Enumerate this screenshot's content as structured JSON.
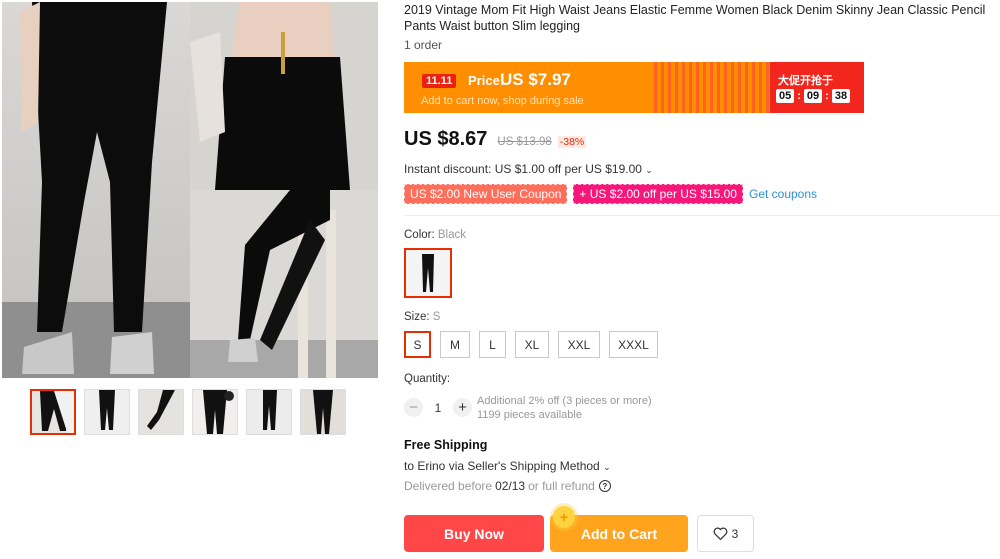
{
  "product": {
    "title": "2019 Vintage Mom Fit High Waist Jeans Elastic Femme Women Black Denim Skinny Jean Classic Pencil Pants Waist button Slim legging",
    "orders": "1 order"
  },
  "promo": {
    "tag": "11.11",
    "price_label": "Price:",
    "price": "US $7.97",
    "subtitle": "Add to cart now, shop during sale",
    "sale_text": "大促开抢于",
    "countdown": [
      "05",
      "09",
      "38"
    ],
    "colors": {
      "bar": "#ff8f00",
      "countdown_bg": "#f2261d"
    }
  },
  "pricing": {
    "current": "US $8.67",
    "original": "US $13.98",
    "discount": "-38%",
    "instant_discount": "Instant discount: US $1.00 off per US $19.00",
    "coupons": [
      "US $2.00 New User Coupon",
      "+ US $2.00 off per US $15.00"
    ],
    "get_coupons": "Get coupons"
  },
  "color": {
    "label": "Color:",
    "value": "Black",
    "swatch_icon": "black-pants-swatch"
  },
  "size": {
    "label": "Size:",
    "value": "S",
    "options": [
      "S",
      "M",
      "L",
      "XL",
      "XXL",
      "XXXL"
    ],
    "selected": "S"
  },
  "quantity": {
    "label": "Quantity:",
    "minus": "−",
    "value": "1",
    "plus": "+",
    "bulk_info": "Additional 2% off (3 pieces or more)",
    "available": "1199 pieces available"
  },
  "shipping": {
    "title": "Free Shipping",
    "to": "to Erino via Seller's Shipping Method",
    "delivered_prefix": "Delivered before",
    "delivered_date": "02/13",
    "delivered_suffix": "or full refund",
    "help_icon": "?"
  },
  "actions": {
    "buy_now": "Buy Now",
    "add_to_cart": "Add to Cart",
    "cart_badge": "+",
    "wishlist_count": "3"
  },
  "theme": {
    "accent": "#e62e04",
    "buy": "#ff4747",
    "cart": "#ffa41c",
    "link": "#2e8fd8"
  }
}
